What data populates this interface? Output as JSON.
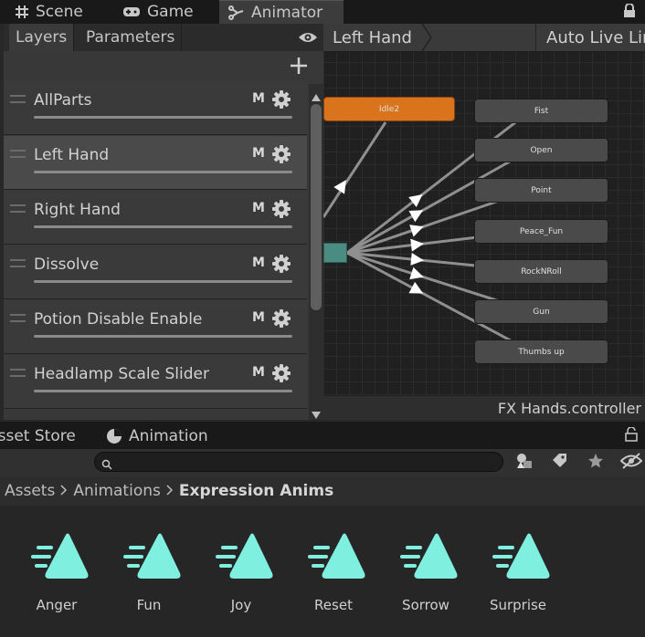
{
  "top_tabs": [
    {
      "label": "Scene",
      "icon": "grid-icon"
    },
    {
      "label": "Game",
      "icon": "gamepad-icon"
    },
    {
      "label": "Animator",
      "icon": "animator-icon"
    }
  ],
  "layers_panel": {
    "tabs": [
      "Layers",
      "Parameters"
    ],
    "items": [
      {
        "label": "AllParts",
        "badge": "M"
      },
      {
        "label": "Left Hand",
        "badge": "M",
        "selected": true
      },
      {
        "label": "Right Hand",
        "badge": "M"
      },
      {
        "label": "Dissolve",
        "badge": "M"
      },
      {
        "label": "Potion Disable Enable",
        "badge": "M"
      },
      {
        "label": "Headlamp Scale Slider",
        "badge": "M"
      }
    ]
  },
  "graph": {
    "breadcrumb": "Left Hand",
    "auto_live": "Auto Live Link",
    "states": [
      {
        "label": "Idle2",
        "color": "#d9731c"
      },
      {
        "label": "Fist"
      },
      {
        "label": "Open"
      },
      {
        "label": "Point"
      },
      {
        "label": "Peace_Fun"
      },
      {
        "label": "RockNRoll"
      },
      {
        "label": "Gun"
      },
      {
        "label": "Thumbs up"
      }
    ],
    "footer": "FX Hands.controller"
  },
  "bottom_tabs": [
    {
      "label": "Asset Store"
    },
    {
      "label": "Animation",
      "icon": "animation-icon"
    }
  ],
  "breadcrumb": {
    "items": [
      "Assets",
      "Animations",
      "Expression Anims"
    ]
  },
  "assets": [
    "Anger",
    "Fun",
    "Joy",
    "Reset",
    "Sorrow",
    "Surprise"
  ],
  "colors": {
    "accent": "#7ff0e0",
    "state_default": "#4a4a4a",
    "state_entry": "#d9731c"
  }
}
